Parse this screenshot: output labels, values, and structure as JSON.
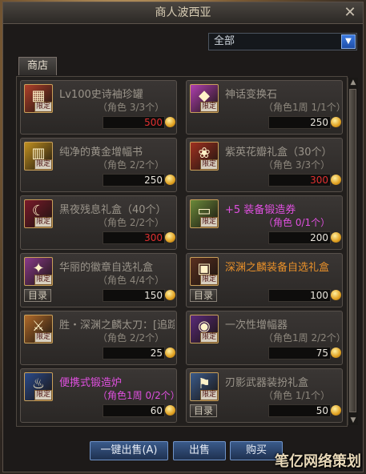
{
  "window": {
    "title": "商人波西亚",
    "close_glyph": "✕"
  },
  "filter": {
    "selected": "全部",
    "arrow_glyph": "▼"
  },
  "tab": {
    "label": "商店"
  },
  "badge_label": "限定",
  "catalog_label": "目录",
  "items": [
    {
      "name": "Lv100史诗袖珍罐",
      "limit": "（角色 3/3个）",
      "price": "500",
      "name_color": "#9a948a",
      "price_color": "#e03030",
      "has_catalog": false,
      "icon": "box-icon",
      "glyph": "▦",
      "icon_color": "#b0402a"
    },
    {
      "name": "神话变换石",
      "limit": "（角色1周 1/1个）",
      "price": "250",
      "name_color": "#9a948a",
      "price_color": "#e8e4dc",
      "has_catalog": false,
      "icon": "stone-icon",
      "glyph": "◆",
      "icon_color": "#b040b0"
    },
    {
      "name": "纯净的黄金增幅书",
      "limit": "（角色 2/2个）",
      "price": "250",
      "name_color": "#9a948a",
      "price_color": "#e8e4dc",
      "has_catalog": false,
      "icon": "book-icon",
      "glyph": "▥",
      "icon_color": "#c09020"
    },
    {
      "name": "紫英花瓣礼盒（30个）",
      "limit": "（角色 3/3个）",
      "price": "300",
      "name_color": "#9a948a",
      "price_color": "#e03030",
      "has_catalog": false,
      "icon": "giftbox-icon",
      "glyph": "❀",
      "icon_color": "#a03020"
    },
    {
      "name": "黑夜残息礼盒（40个）",
      "limit": "（角色 2/2个）",
      "price": "300",
      "name_color": "#9a948a",
      "price_color": "#e03030",
      "has_catalog": false,
      "icon": "scythe-icon",
      "glyph": "☾",
      "icon_color": "#7a1a2a"
    },
    {
      "name": "+5 装备锻造券",
      "limit": "（角色 0/1个）",
      "price": "200",
      "name_color": "#e050e0",
      "price_color": "#e8e4dc",
      "has_catalog": false,
      "icon": "ticket-icon",
      "glyph": "▭",
      "icon_color": "#6a8a3a"
    },
    {
      "name": "华丽的徽章自选礼盒",
      "limit": "（角色 4/4个）",
      "price": "150",
      "name_color": "#9a948a",
      "price_color": "#e8e4dc",
      "has_catalog": true,
      "icon": "emblem-box-icon",
      "glyph": "✦",
      "icon_color": "#8a3a8a"
    },
    {
      "name": "深渊之麟装备自选礼盒",
      "limit": "",
      "price": "100",
      "name_color": "#e8902a",
      "price_color": "#e8e4dc",
      "has_catalog": true,
      "icon": "equipment-box-icon",
      "glyph": "▣",
      "icon_color": "#5a3020"
    },
    {
      "name": "胜・深渊之麟太刀：[追踪...",
      "limit": "（角色 2/2个）",
      "price": "25",
      "name_color": "#9a948a",
      "price_color": "#e8e4dc",
      "has_catalog": false,
      "icon": "sword-icon",
      "glyph": "⚔",
      "icon_color": "#b06a2a"
    },
    {
      "name": "一次性增幅器",
      "limit": "（角色1周 2/2个）",
      "price": "75",
      "name_color": "#9a948a",
      "price_color": "#e8e4dc",
      "has_catalog": false,
      "icon": "amplifier-icon",
      "glyph": "◉",
      "icon_color": "#5a2a7a"
    },
    {
      "name": "便携式锻造炉",
      "limit": "（角色1周 0/2个）",
      "price": "60",
      "name_color": "#e050e0",
      "price_color": "#e8e4dc",
      "has_catalog": false,
      "icon": "forge-icon",
      "glyph": "♨",
      "icon_color": "#2a4a8a"
    },
    {
      "name": "刃影武器装扮礼盒",
      "limit": "（角色 1/1个）",
      "price": "50",
      "name_color": "#9a948a",
      "price_color": "#e8e4dc",
      "has_catalog": true,
      "icon": "weapon-gift-icon",
      "glyph": "⚑",
      "icon_color": "#3a5a8a"
    }
  ],
  "buttons": {
    "sell_all": "一键出售(A)",
    "sell": "出售",
    "buy": "购买"
  },
  "watermark": "笔亿网络策划"
}
